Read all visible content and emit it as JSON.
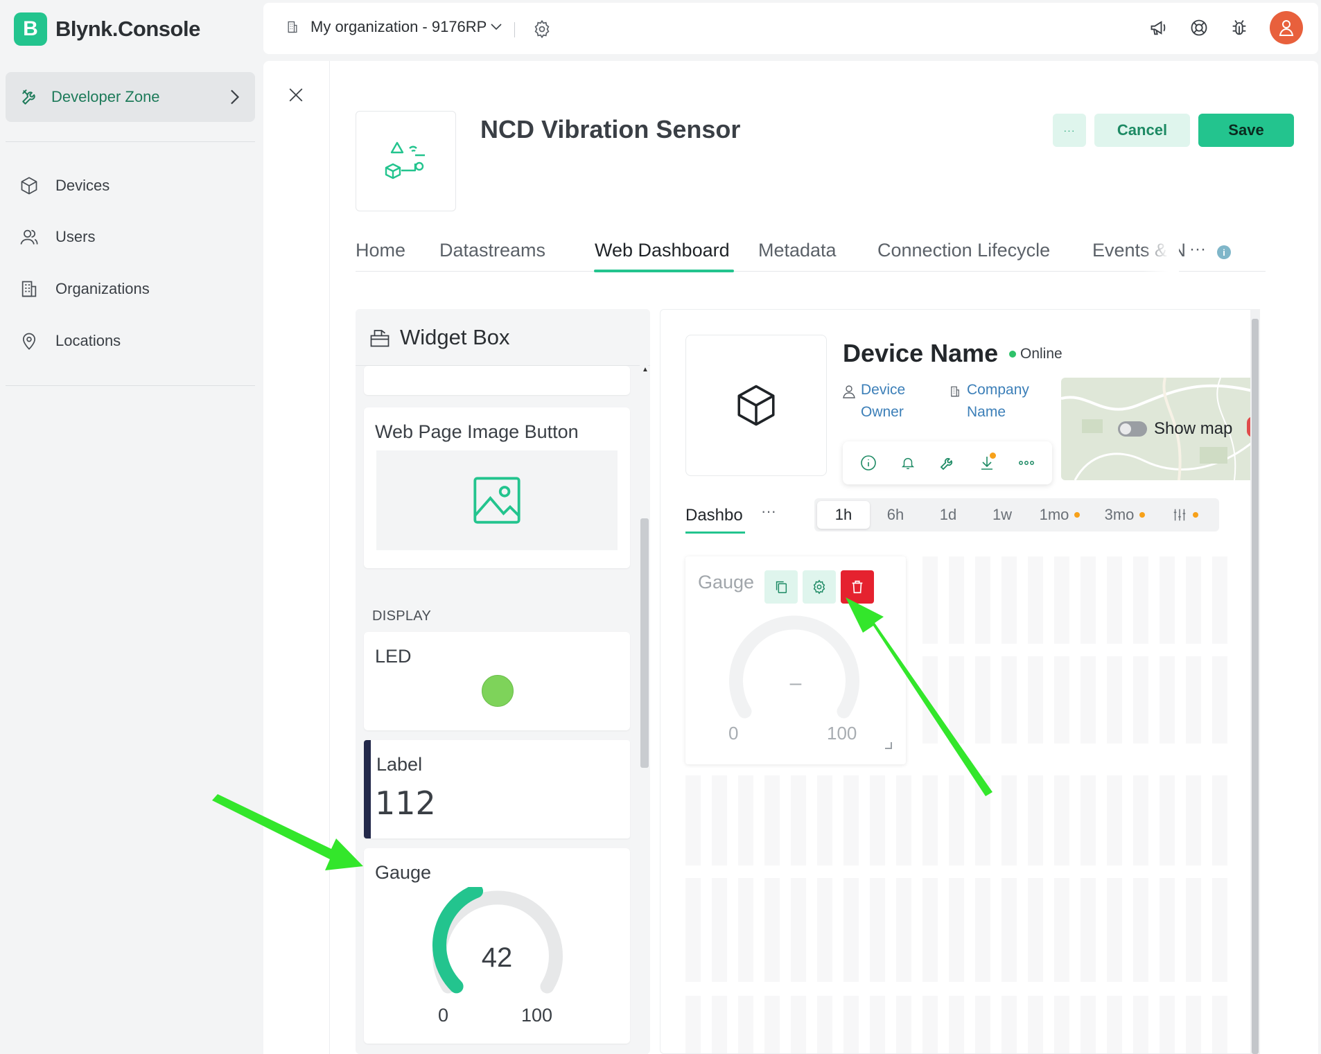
{
  "brand": {
    "mark": "B",
    "name": "Blynk.Console"
  },
  "sidebar": {
    "developer_zone": "Developer Zone",
    "items": [
      {
        "label": "Devices",
        "icon": "cube-icon"
      },
      {
        "label": "Users",
        "icon": "users-icon"
      },
      {
        "label": "Organizations",
        "icon": "building-icon"
      },
      {
        "label": "Locations",
        "icon": "location-pin-icon"
      }
    ]
  },
  "topbar": {
    "organization": "My organization - 9176RP"
  },
  "template": {
    "title": "NCD Vibration Sensor",
    "more_label": "···",
    "cancel_label": "Cancel",
    "save_label": "Save"
  },
  "tabs": {
    "items": [
      "Home",
      "Datastreams",
      "Web Dashboard",
      "Metadata",
      "Connection Lifecycle",
      "Events & N"
    ],
    "active": "Web Dashboard",
    "more": "···",
    "info": "i"
  },
  "widget_box": {
    "title": "Widget Box",
    "image_button": {
      "name": "Web Page Image Button"
    },
    "section": "DISPLAY",
    "led": {
      "name": "LED",
      "color": "#7ed35a"
    },
    "label_widget": {
      "name": "Label",
      "value": "112",
      "accent": "#23294a"
    },
    "gauge": {
      "name": "Gauge",
      "value": "42",
      "min": "0",
      "max": "100",
      "fraction": 0.42,
      "accent": "#23c48e"
    }
  },
  "device": {
    "name": "Device Name",
    "status": "Online",
    "owner_label": "Device Owner",
    "company_label": "Company Name",
    "show_map": "Show map"
  },
  "dashboard": {
    "tab": "Dashbo",
    "more": "···",
    "ranges": [
      {
        "label": "1h",
        "active": true,
        "dot": false
      },
      {
        "label": "6h",
        "active": false,
        "dot": false
      },
      {
        "label": "1d",
        "active": false,
        "dot": false
      },
      {
        "label": "1w",
        "active": false,
        "dot": false
      },
      {
        "label": "1mo",
        "active": false,
        "dot": true
      },
      {
        "label": "3mo",
        "active": false,
        "dot": true
      }
    ],
    "gauge": {
      "name": "Gauge",
      "value": "–",
      "min": "0",
      "max": "100"
    }
  },
  "colors": {
    "brand_green": "#23c48e",
    "delete_red": "#e5222f",
    "arrow_green": "#33e62b",
    "link_blue": "#3c7fb8"
  }
}
